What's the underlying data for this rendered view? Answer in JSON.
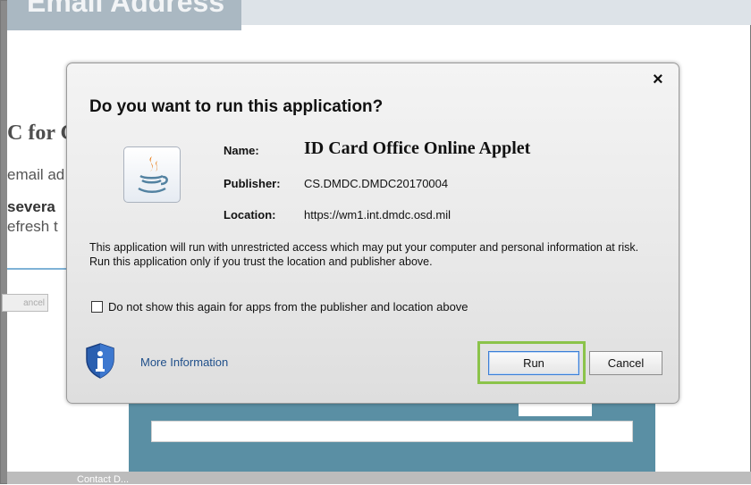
{
  "background": {
    "header_text": "Email Address",
    "title_fragment": "C for C",
    "line1_fragment": "email ad",
    "line2_fragment": "severa",
    "line3_fragment": "efresh t",
    "cancel_fragment": "ancel",
    "footer_text": "Contact D..."
  },
  "dialog": {
    "close_glyph": "×",
    "title": "Do you want to run this application?",
    "name_label": "Name:",
    "name_value": "ID Card Office Online Applet",
    "publisher_label": "Publisher:",
    "publisher_value": "CS.DMDC.DMDC20170004",
    "location_label": "Location:",
    "location_value": "https://wm1.int.dmdc.osd.mil",
    "warning_text": "This application will run with unrestricted access which may put your computer and personal information at risk. Run this application only if you trust the location and publisher above.",
    "checkbox_label": "Do not show this again for apps from the publisher and location above",
    "checkbox_checked": false,
    "more_info_label": "More Information",
    "run_label": "Run",
    "cancel_label": "Cancel",
    "icons": {
      "app": "java-cup-icon",
      "info": "info-shield-icon",
      "close": "close-icon"
    },
    "colors": {
      "highlight": "#8bc34a",
      "link": "#1f4f8a",
      "shield": "#2a5fb0"
    }
  }
}
